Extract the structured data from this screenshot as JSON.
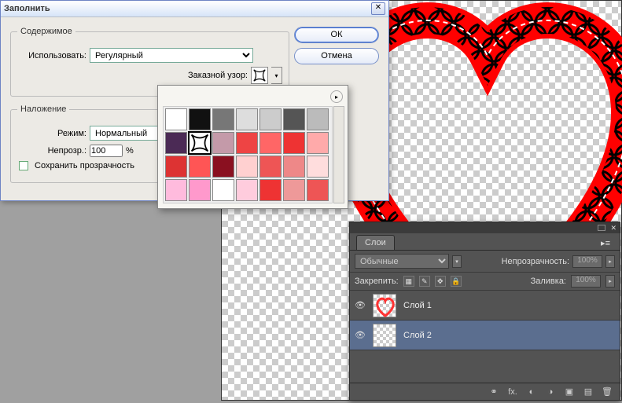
{
  "dialog": {
    "title": "Заполнить",
    "ok": "ОК",
    "cancel": "Отмена",
    "contents_legend": "Содержимое",
    "use_label": "Использовать:",
    "use_value": "Регулярный",
    "pattern_label": "Заказной узор:",
    "blending_legend": "Наложение",
    "mode_label": "Режим:",
    "mode_value": "Нормальный",
    "opacity_label": "Непрозр.:",
    "opacity_value": "100",
    "opacity_pct": "%",
    "preserve_label": "Сохранить прозрачность"
  },
  "patterns": {
    "colors": [
      "#ffffff",
      "#111111",
      "#777777",
      "#dddddd",
      "#cccccc",
      "#555555",
      "#bbbbbb",
      "#4b2a55",
      "#ffffff",
      "#c49aa9",
      "#e44",
      "#f66",
      "#e33",
      "#faa",
      "#d33",
      "#f55",
      "#8a1020",
      "#ffd0d0",
      "#e55",
      "#e88",
      "#fdd",
      "#fbd",
      "#f9c",
      "#fff",
      "#fcd",
      "#e33",
      "#e99",
      "#e55"
    ],
    "selected_index": 8
  },
  "layers_panel": {
    "tab": "Слои",
    "blend_value": "Обычные",
    "opacity_label": "Непрозрачность:",
    "opacity_value": "100%",
    "lock_label": "Закрепить:",
    "fill_label": "Заливка:",
    "fill_value": "100%",
    "items": [
      {
        "name": "Слой 1",
        "selected": false
      },
      {
        "name": "Слой 2",
        "selected": true
      }
    ],
    "footer_fx": "fx."
  }
}
